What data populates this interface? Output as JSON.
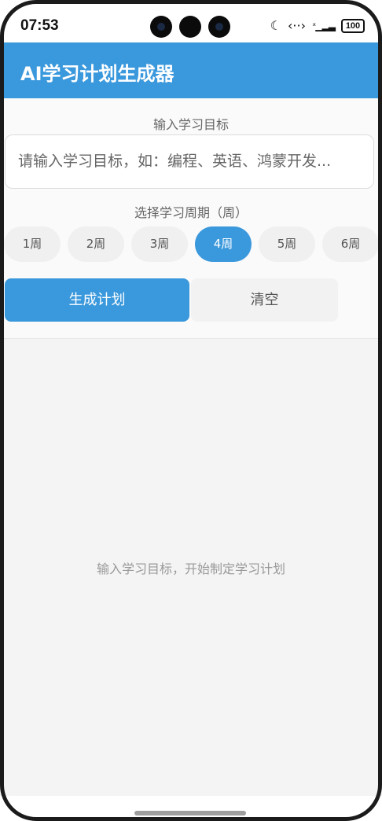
{
  "status_bar": {
    "time": "07:53",
    "icons": [
      "moon-icon",
      "nfc-icon",
      "signal-icon"
    ],
    "battery": "100"
  },
  "app_bar": {
    "title": "AI学习计划生成器"
  },
  "form": {
    "goal_label": "输入学习目标",
    "goal_placeholder": "请输入学习目标，如：编程、英语、鸿蒙开发...",
    "period_label": "选择学习周期（周）",
    "weeks": [
      {
        "label": "1周",
        "active": false
      },
      {
        "label": "2周",
        "active": false
      },
      {
        "label": "3周",
        "active": false
      },
      {
        "label": "4周",
        "active": true
      },
      {
        "label": "5周",
        "active": false
      },
      {
        "label": "6周",
        "active": false
      }
    ],
    "generate_label": "生成计划",
    "clear_label": "清空"
  },
  "empty_state": {
    "hint": "输入学习目标，开始制定学习计划"
  },
  "colors": {
    "accent": "#3a98dc",
    "panel": "#fafafa",
    "background": "#f4f4f4"
  }
}
